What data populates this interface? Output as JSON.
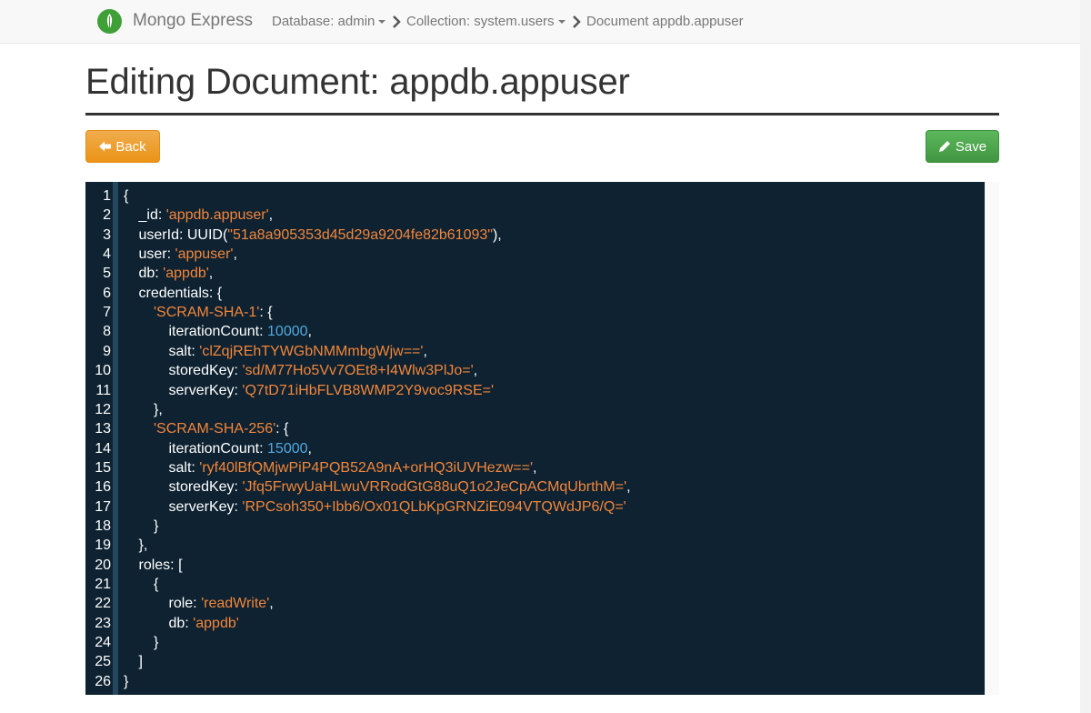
{
  "navbar": {
    "brand": "Mongo Express",
    "breadcrumbs": [
      {
        "label": "Database: admin",
        "dropdown": true
      },
      {
        "label": "Collection: system.users",
        "dropdown": true
      },
      {
        "label": "Document appdb.appuser",
        "dropdown": false
      }
    ]
  },
  "page": {
    "title": "Editing Document: appdb.appuser"
  },
  "buttons": {
    "back": "Back",
    "save": "Save"
  },
  "colors": {
    "back": "#f0ad4e",
    "save": "#5cb85c",
    "editor_bg": "#0e2231",
    "string": "#f3863a",
    "number": "#54a9df",
    "brand": "#3fa037"
  },
  "editor": {
    "lines": [
      {
        "n": "1",
        "indent": 0,
        "segs": [
          [
            "p",
            "{"
          ]
        ]
      },
      {
        "n": "2",
        "indent": 1,
        "segs": [
          [
            "p",
            "_id: "
          ],
          [
            "s",
            "'appdb.appuser'"
          ],
          [
            "p",
            ","
          ]
        ]
      },
      {
        "n": "3",
        "indent": 1,
        "segs": [
          [
            "p",
            "userId: UUID("
          ],
          [
            "s",
            "\"51a8a905353d45d29a9204fe82b61093\""
          ],
          [
            "p",
            "),"
          ]
        ]
      },
      {
        "n": "4",
        "indent": 1,
        "segs": [
          [
            "p",
            "user: "
          ],
          [
            "s",
            "'appuser'"
          ],
          [
            "p",
            ","
          ]
        ]
      },
      {
        "n": "5",
        "indent": 1,
        "segs": [
          [
            "p",
            "db: "
          ],
          [
            "s",
            "'appdb'"
          ],
          [
            "p",
            ","
          ]
        ]
      },
      {
        "n": "6",
        "indent": 1,
        "segs": [
          [
            "p",
            "credentials: {"
          ]
        ]
      },
      {
        "n": "7",
        "indent": 2,
        "segs": [
          [
            "s",
            "'SCRAM-SHA-1'"
          ],
          [
            "p",
            ": {"
          ]
        ]
      },
      {
        "n": "8",
        "indent": 3,
        "segs": [
          [
            "p",
            "iterationCount: "
          ],
          [
            "n",
            "10000"
          ],
          [
            "p",
            ","
          ]
        ]
      },
      {
        "n": "9",
        "indent": 3,
        "segs": [
          [
            "p",
            "salt: "
          ],
          [
            "s",
            "'clZqjREhTYWGbNMMmbgWjw=='"
          ],
          [
            "p",
            ","
          ]
        ]
      },
      {
        "n": "10",
        "indent": 3,
        "segs": [
          [
            "p",
            "storedKey: "
          ],
          [
            "s",
            "'sd/M77Ho5Vv7OEt8+I4Wlw3PlJo='"
          ],
          [
            "p",
            ","
          ]
        ]
      },
      {
        "n": "11",
        "indent": 3,
        "segs": [
          [
            "p",
            "serverKey: "
          ],
          [
            "s",
            "'Q7tD71iHbFLVB8WMP2Y9voc9RSE='"
          ]
        ]
      },
      {
        "n": "12",
        "indent": 2,
        "segs": [
          [
            "p",
            "},"
          ]
        ]
      },
      {
        "n": "13",
        "indent": 2,
        "segs": [
          [
            "s",
            "'SCRAM-SHA-256'"
          ],
          [
            "p",
            ": {"
          ]
        ]
      },
      {
        "n": "14",
        "indent": 3,
        "segs": [
          [
            "p",
            "iterationCount: "
          ],
          [
            "n",
            "15000"
          ],
          [
            "p",
            ","
          ]
        ]
      },
      {
        "n": "15",
        "indent": 3,
        "segs": [
          [
            "p",
            "salt: "
          ],
          [
            "s",
            "'ryf40lBfQMjwPiP4PQB52A9nA+orHQ3iUVHezw=='"
          ],
          [
            "p",
            ","
          ]
        ]
      },
      {
        "n": "16",
        "indent": 3,
        "segs": [
          [
            "p",
            "storedKey: "
          ],
          [
            "s",
            "'Jfq5FrwyUaHLwuVRRodGtG88uQ1o2JeCpACMqUbrthM='"
          ],
          [
            "p",
            ","
          ]
        ]
      },
      {
        "n": "17",
        "indent": 3,
        "segs": [
          [
            "p",
            "serverKey: "
          ],
          [
            "s",
            "'RPCsoh350+Ibb6/Ox01QLbKpGRNZiE094VTQWdJP6/Q='"
          ]
        ]
      },
      {
        "n": "18",
        "indent": 2,
        "segs": [
          [
            "p",
            "}"
          ]
        ]
      },
      {
        "n": "19",
        "indent": 1,
        "segs": [
          [
            "p",
            "},"
          ]
        ]
      },
      {
        "n": "20",
        "indent": 1,
        "segs": [
          [
            "p",
            "roles: ["
          ]
        ]
      },
      {
        "n": "21",
        "indent": 2,
        "segs": [
          [
            "p",
            "{"
          ]
        ]
      },
      {
        "n": "22",
        "indent": 3,
        "segs": [
          [
            "p",
            "role: "
          ],
          [
            "s",
            "'readWrite'"
          ],
          [
            "p",
            ","
          ]
        ]
      },
      {
        "n": "23",
        "indent": 3,
        "segs": [
          [
            "p",
            "db: "
          ],
          [
            "s",
            "'appdb'"
          ]
        ]
      },
      {
        "n": "24",
        "indent": 2,
        "segs": [
          [
            "p",
            "}"
          ]
        ]
      },
      {
        "n": "25",
        "indent": 1,
        "segs": [
          [
            "p",
            "]"
          ]
        ]
      },
      {
        "n": "26",
        "indent": 0,
        "segs": [
          [
            "p",
            "}"
          ]
        ]
      }
    ]
  }
}
